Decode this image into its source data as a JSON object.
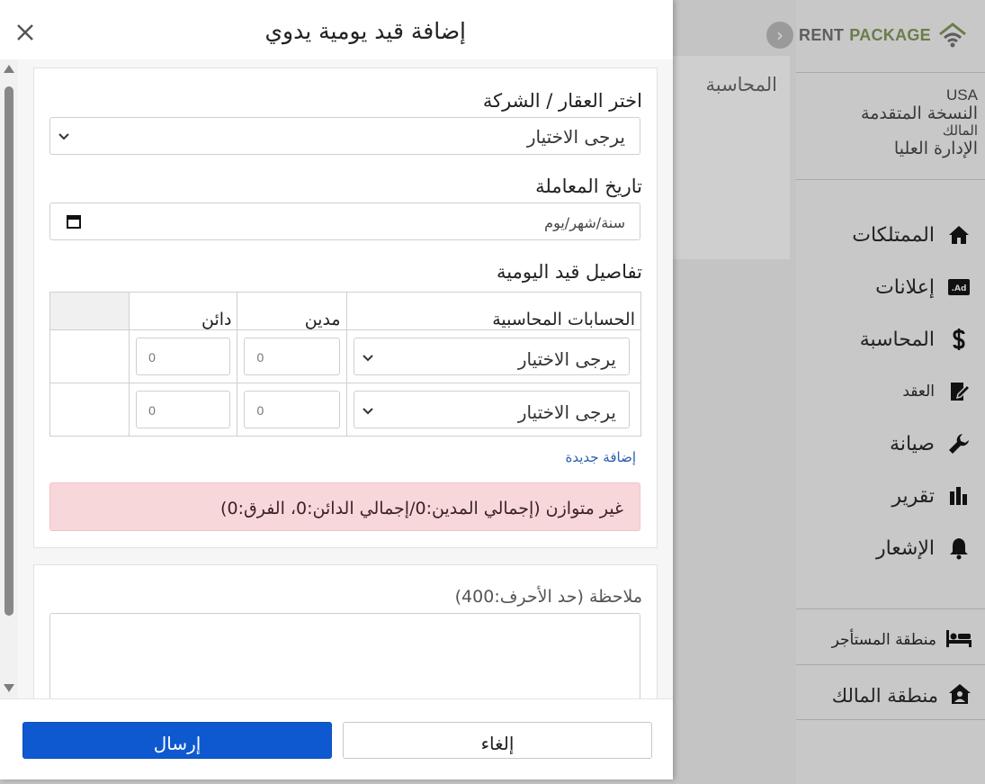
{
  "background": {
    "panel_title": "المحاسبة"
  },
  "sidebar": {
    "logo_rent": "RENT",
    "logo_package": "PACKAGE",
    "user": {
      "country": "USA",
      "plan": "النسخة المتقدمة",
      "role": "المالك",
      "level": "الإدارة العليا"
    },
    "nav": [
      {
        "label": "الممتلكات",
        "icon": "home-icon"
      },
      {
        "label": "إعلانات",
        "icon": "ad-icon"
      },
      {
        "label": "المحاسبة",
        "icon": "dollar-icon"
      },
      {
        "label": "العقد",
        "icon": "contract-icon"
      },
      {
        "label": "صيانة",
        "icon": "wrench-icon"
      },
      {
        "label": "تقرير",
        "icon": "chart-icon"
      },
      {
        "label": "الإشعار",
        "icon": "bell-icon"
      }
    ],
    "tenant_zone": "منطقة المستأجر",
    "owner_zone": "منطقة المالك"
  },
  "modal": {
    "title": "إضافة قيد يومية يدوي",
    "property_label": "اختر العقار / الشركة",
    "property_value": "يرجى الاختيار",
    "date_label": "تاريخ المعاملة",
    "date_placeholder": "سنة/شهر/يوم",
    "details_label": "تفاصيل قيد اليومية",
    "table": {
      "headers": [
        "الحسابات المحاسبية",
        "مدين",
        "دائن",
        ""
      ],
      "rows": [
        {
          "account": "يرجى الاختيار",
          "debit": "0",
          "credit": "0"
        },
        {
          "account": "يرجى الاختيار",
          "debit": "0",
          "credit": "0"
        }
      ]
    },
    "add_new": "إضافة جديدة",
    "alert": "غير متوازن (إجمالي المدين:0/إجمالي الدائن:0، الفرق:0)",
    "note_label": "ملاحظة (حد الأحرف:400)",
    "submit": "إرسال",
    "cancel": "إلغاء"
  },
  "colors": {
    "primary": "#0e59d0",
    "alert_bg": "#f8d7da",
    "link": "#2a5db0",
    "logo_green": "#6b7c4a"
  }
}
